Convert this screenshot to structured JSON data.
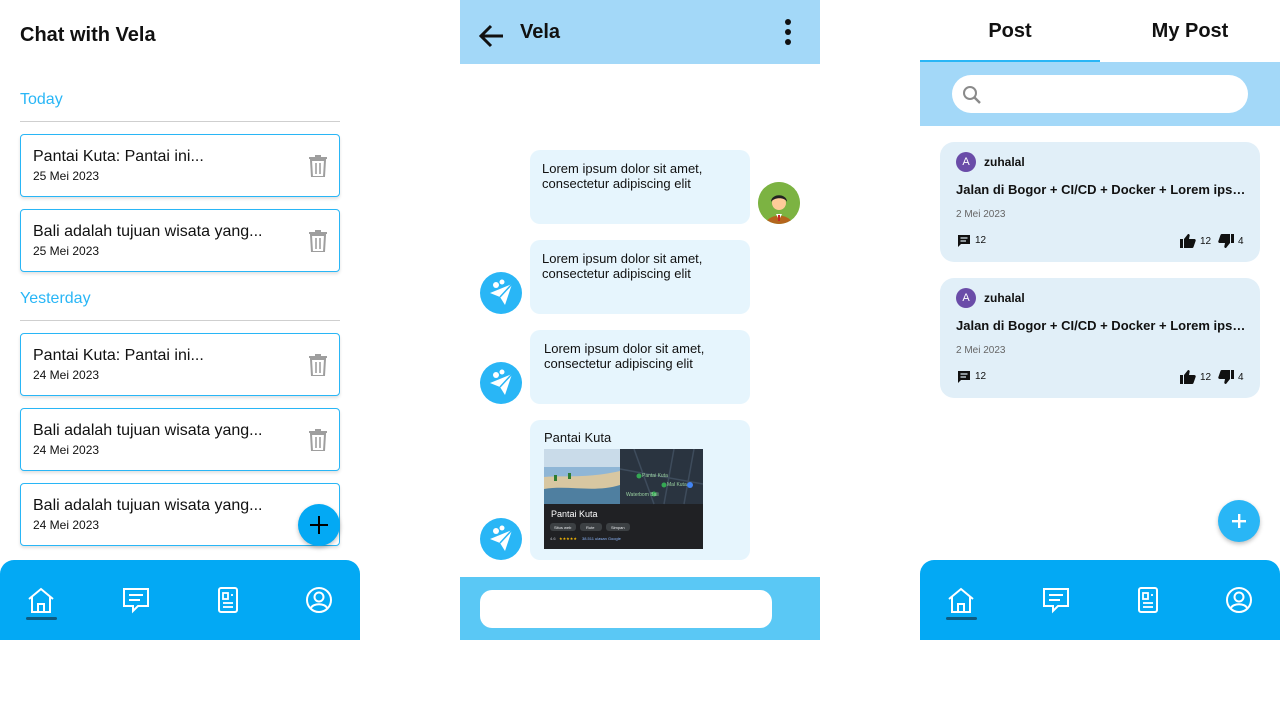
{
  "screen1": {
    "title": "Chat with Vela",
    "sections": [
      {
        "label": "Today",
        "items": [
          {
            "title": "Pantai Kuta: Pantai ini...",
            "date": "25 Mei 2023"
          },
          {
            "title": "Bali adalah tujuan wisata yang...",
            "date": "25 Mei 2023"
          }
        ]
      },
      {
        "label": "Yesterday",
        "items": [
          {
            "title": "Pantai Kuta: Pantai ini...",
            "date": "24 Mei 2023"
          },
          {
            "title": "Bali adalah tujuan wisata yang...",
            "date": "24 Mei 2023"
          },
          {
            "title": "Bali adalah tujuan wisata yang...",
            "date": "24 Mei 2023"
          }
        ]
      }
    ],
    "fab_icon": "plus-icon",
    "nav": [
      "home-icon",
      "chat-icon",
      "article-icon",
      "profile-icon"
    ]
  },
  "screen2": {
    "header_title": "Vela",
    "messages": [
      {
        "sender": "user",
        "text": "Lorem ipsum dolor sit amet, consectetur adipiscing elit"
      },
      {
        "sender": "bot",
        "text": "Lorem ipsum dolor sit amet, consectetur adipiscing elit"
      },
      {
        "sender": "bot",
        "text": "Lorem ipsum dolor sit amet, consectetur adipiscing elit"
      },
      {
        "sender": "bot",
        "text": "Pantai Kuta",
        "map": {
          "place_name": "Pantai Kuta",
          "labels": [
            "Pantai Kuta",
            "Mal Kuta",
            "Waterbom Bali"
          ],
          "rating": "4.6",
          "stars": "★★★★★",
          "reviews": "38.511 ulasan Google",
          "buttons": [
            "Situs web",
            "Rute",
            "Simpan"
          ]
        }
      }
    ],
    "input_placeholder": ""
  },
  "screen3": {
    "tabs": [
      "Post",
      "My Post"
    ],
    "active_tab": 0,
    "search_placeholder": "",
    "posts": [
      {
        "avatar": "A",
        "author": "zuhalal",
        "title": "Jalan di Bogor + CI/CD + Docker + Lorem ipsum dolor sit amet",
        "date": "2 Mei 2023",
        "comments": "12",
        "likes": "12",
        "dislikes": "4"
      },
      {
        "avatar": "A",
        "author": "zuhalal",
        "title": "Jalan di Bogor + CI/CD + Docker + Lorem ipsum dolor sit amet",
        "date": "2 Mei 2023",
        "comments": "12",
        "likes": "12",
        "dislikes": "4"
      }
    ],
    "fab_icon": "plus-icon",
    "nav": [
      "home-icon",
      "chat-icon",
      "article-icon",
      "profile-icon"
    ]
  },
  "colors": {
    "primary": "#03a9f4",
    "accent": "#29b6f6",
    "header": "#a3d8f8",
    "bubble": "#e6f5fd",
    "post_card": "#e1eff8"
  }
}
